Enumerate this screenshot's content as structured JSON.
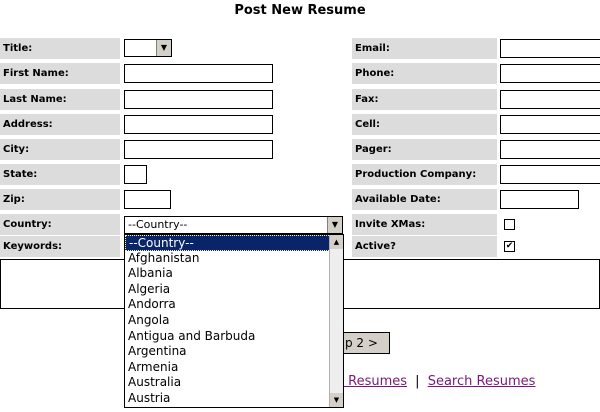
{
  "page_title": "Post New Resume",
  "left_fields": [
    {
      "label": "Title:",
      "type": "select",
      "value": ""
    },
    {
      "label": "First Name:",
      "type": "text"
    },
    {
      "label": "Last Name:",
      "type": "text"
    },
    {
      "label": "Address:",
      "type": "text"
    },
    {
      "label": "City:",
      "type": "text"
    },
    {
      "label": "State:",
      "type": "text"
    },
    {
      "label": "Zip:",
      "type": "text"
    },
    {
      "label": "Country:",
      "type": "select",
      "value": "--Country--"
    },
    {
      "label": "Keywords:",
      "type": "textarea"
    }
  ],
  "right_fields": [
    {
      "label": "Email:"
    },
    {
      "label": "Phone:"
    },
    {
      "label": "Fax:"
    },
    {
      "label": "Cell:"
    },
    {
      "label": "Pager:"
    },
    {
      "label": "Production Company:"
    },
    {
      "label": "Available Date:"
    },
    {
      "label": "Invite XMas:",
      "checked": false
    },
    {
      "label": "Active?",
      "checked": true
    }
  ],
  "check_mark": "✔",
  "country_dropdown": {
    "options": [
      "--Country--",
      "Afghanistan",
      "Albania",
      "Algeria",
      "Andorra",
      "Angola",
      "Antigua and Barbuda",
      "Argentina",
      "Armenia",
      "Australia",
      "Austria"
    ],
    "selected": "--Country--"
  },
  "submit_button_label": "p 2 >",
  "footer_links": {
    "left_partial": "e Resumes",
    "separator": "|",
    "search": "Search Resumes"
  },
  "icons": {
    "dropdown_arrow": "▼",
    "scroll_up": "▲",
    "scroll_down": "▼"
  }
}
